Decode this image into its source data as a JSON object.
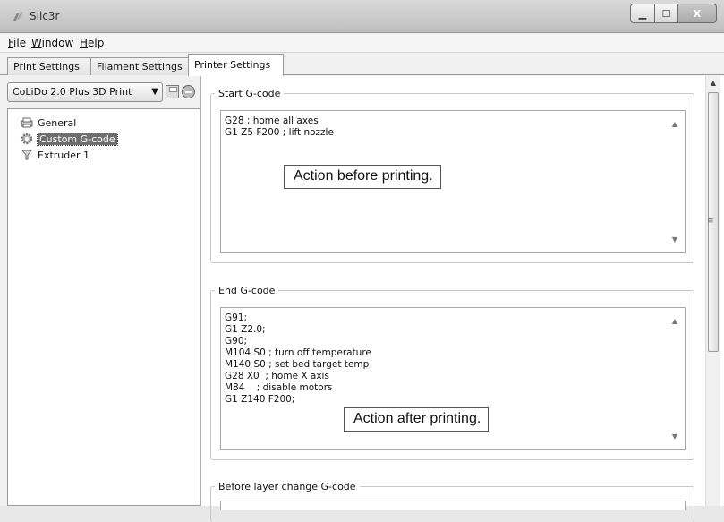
{
  "window": {
    "title": "Slic3r",
    "minimize_glyph": "▁",
    "maximize_glyph": "☐",
    "close_glyph": "X"
  },
  "menu": {
    "items": [
      {
        "label_ul": "F",
        "label_rest": "ile"
      },
      {
        "label_ul": "W",
        "label_rest": "indow"
      },
      {
        "label_ul": "H",
        "label_rest": "elp"
      }
    ]
  },
  "tabs": [
    {
      "label": "Print Settings",
      "active": false
    },
    {
      "label": "Filament Settings",
      "active": false
    },
    {
      "label": "Printer Settings",
      "active": true
    }
  ],
  "preset": {
    "selected": "CoLiDo 2.0 Plus 3D Print",
    "arrow": "▼",
    "save_icon": "save-icon",
    "delete_icon": "delete-icon"
  },
  "tree": [
    {
      "label": "General",
      "icon": "printer-icon",
      "selected": false
    },
    {
      "label": "Custom G-code",
      "icon": "gear-icon",
      "selected": true
    },
    {
      "label": "Extruder 1",
      "icon": "funnel-icon",
      "selected": false
    }
  ],
  "sections": {
    "start": {
      "title": "Start G-code",
      "lines": [
        "G28 ; home all axes",
        "G1 Z5 F200 ; lift nozzle"
      ],
      "annotation": "Action before printing."
    },
    "end": {
      "title": "End G-code",
      "lines": [
        "G91;",
        "G1 Z2.0;",
        "G90;",
        "M104 S0 ; turn off temperature",
        "M140 S0 ; set bed target temp",
        "G28 X0  ; home X axis",
        "M84    ; disable motors",
        "G1 Z140 F200;"
      ],
      "annotation": "Action after printing."
    },
    "before_layer": {
      "title": "Before layer change G-code"
    }
  },
  "scroll": {
    "up_arrow": "▲",
    "down_arrow": "▼",
    "grip": "≡"
  }
}
